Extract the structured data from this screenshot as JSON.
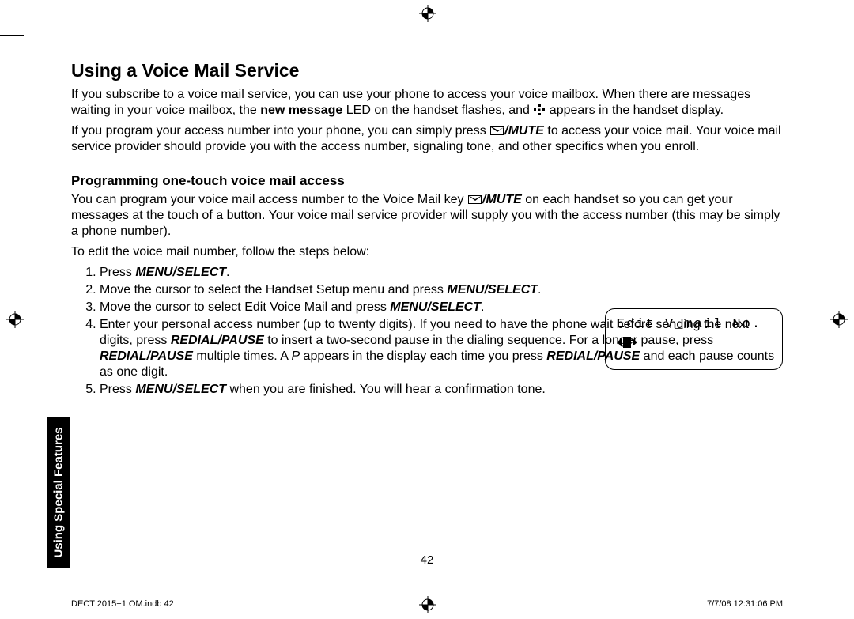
{
  "h1": "Using a Voice Mail Service",
  "p1a": "If you subscribe to a voice mail service, you can use your phone to access your voice mailbox. When there are messages waiting in your voice mailbox, the ",
  "p1b": "new message",
  "p1c": " LED on the handset flashes, and ",
  "p1d": " appears in the handset display.",
  "p2a": "If you program your access number into your phone, you can simply press ",
  "p2b": "/MUTE",
  "p2c": " to access your voice mail. Your voice mail service provider should provide you with the access number, signaling tone, and other specifics when you enroll.",
  "h2": "Programming one-touch voice mail access",
  "p3a": "You can program your voice mail access number to the Voice Mail key ",
  "p3b": "/MUTE",
  "p3c": " on each handset so you can get your messages at the touch of a button. Your voice mail service provider will supply you with the access number (this may be simply a phone number).",
  "p4": "To edit the voice mail number, follow the steps below:",
  "steps": {
    "s1a": "Press ",
    "s1b": "MENU/SELECT",
    "s1c": ".",
    "s2a": "Move the cursor to select the Handset Setup menu and press ",
    "s2b": "MENU/SELECT",
    "s2c": ".",
    "s3a": "Move the cursor to select Edit Voice Mail and press ",
    "s3b": "MENU/SELECT",
    "s3c": ".",
    "s4a": "Enter your personal access number (up to twenty digits). If you need to have the phone wait before sending the next digits, press ",
    "s4b": "REDIAL/PAUSE",
    "s4c": " to insert a two-second pause in the dialing sequence. For a longer pause, press ",
    "s4d": "REDIAL/PAUSE",
    "s4e": " multiple times. A ",
    "s4f": "P",
    "s4g": " appears in the display each time you press ",
    "s4h": "REDIAL/PAUSE",
    "s4i": " and each pause counts as one digit.",
    "s5a": "Press ",
    "s5b": "MENU/SELECT",
    "s5c": " when you are finished. You will hear a confirmation tone."
  },
  "lcd_line1": "Edit V_mail No.",
  "page_num": "42",
  "side_tab": "Using Special Features",
  "footer_left": "DECT 2015+1 OM.indb   42",
  "footer_right": "7/7/08   12:31:06 PM"
}
